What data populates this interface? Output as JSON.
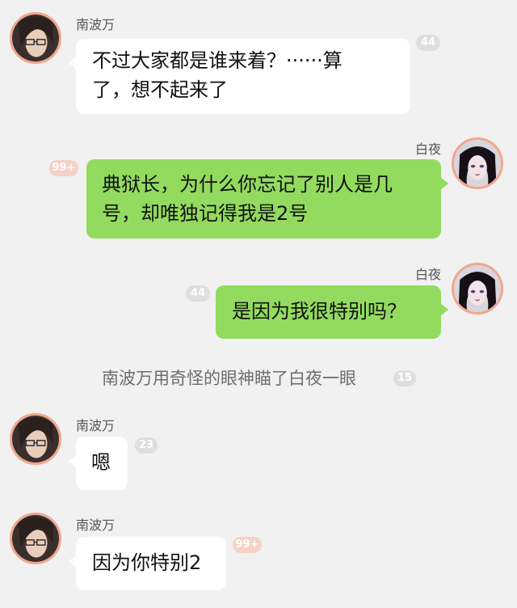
{
  "messages": [
    {
      "sender": "南波万",
      "side": "left",
      "text_lines": [
        "不过大家都是谁来着？······算",
        "了，想不起来了"
      ],
      "badge": "44"
    },
    {
      "sender": "白夜",
      "side": "right",
      "text_lines": [
        "典狱长，为什么你忘记了别人是几",
        "号，却唯独记得我是2号"
      ],
      "badge": "99+"
    },
    {
      "sender": "白夜",
      "side": "right",
      "text_lines": [
        "是因为我很特别吗？"
      ],
      "badge": "44"
    },
    {
      "system_text": "南波万用奇怪的眼神瞄了白夜一眼",
      "badge": "15"
    },
    {
      "sender": "南波万",
      "side": "left",
      "text_lines": [
        "嗯"
      ],
      "badge": "23"
    },
    {
      "sender": "南波万",
      "side": "left",
      "text_lines": [
        "因为你特别2"
      ],
      "badge": "99+"
    }
  ],
  "colors": {
    "background": "#f1f1f1",
    "bubble_left": "#ffffff",
    "bubble_right": "#93db5f",
    "avatar_ring": "#f1a68e",
    "badge_gray": "#dedede",
    "badge_pink": "#f6d1c6"
  },
  "icons": {
    "nanbowan_avatar": "avatar-nanbowan-icon",
    "baiye_avatar": "avatar-baiye-icon"
  }
}
